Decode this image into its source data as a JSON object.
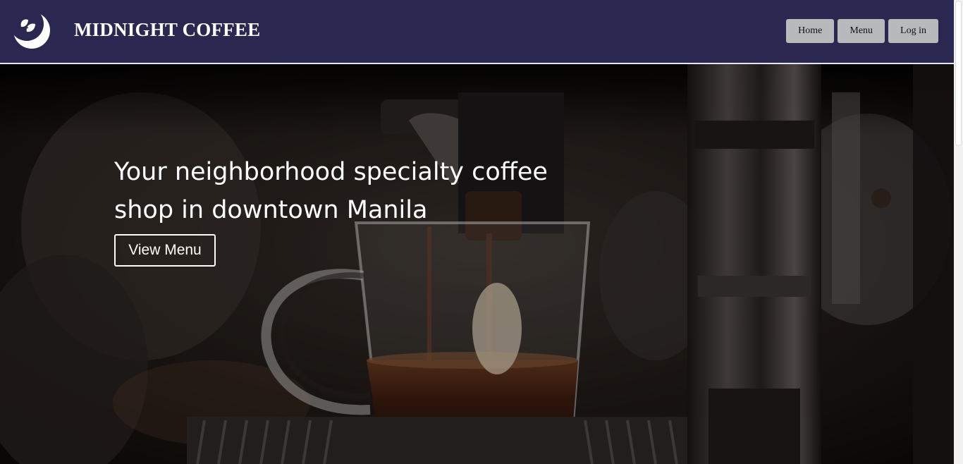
{
  "header": {
    "brand": "MIDNIGHT COFFEE",
    "logo_icon": "crescent-moon-leaf-icon",
    "nav": [
      {
        "label": "Home"
      },
      {
        "label": "Menu"
      },
      {
        "label": "Log in"
      }
    ]
  },
  "hero": {
    "headline_line1": "Your neighborhood specialty coffee",
    "headline_line2": "shop in downtown Manila",
    "cta_label": "View Menu",
    "background": "espresso-pouring-into-glass-mug-photo"
  },
  "colors": {
    "header_bg": "#2a2850",
    "nav_button_bg": "#b8b9bb",
    "hero_text": "#ffffff"
  }
}
